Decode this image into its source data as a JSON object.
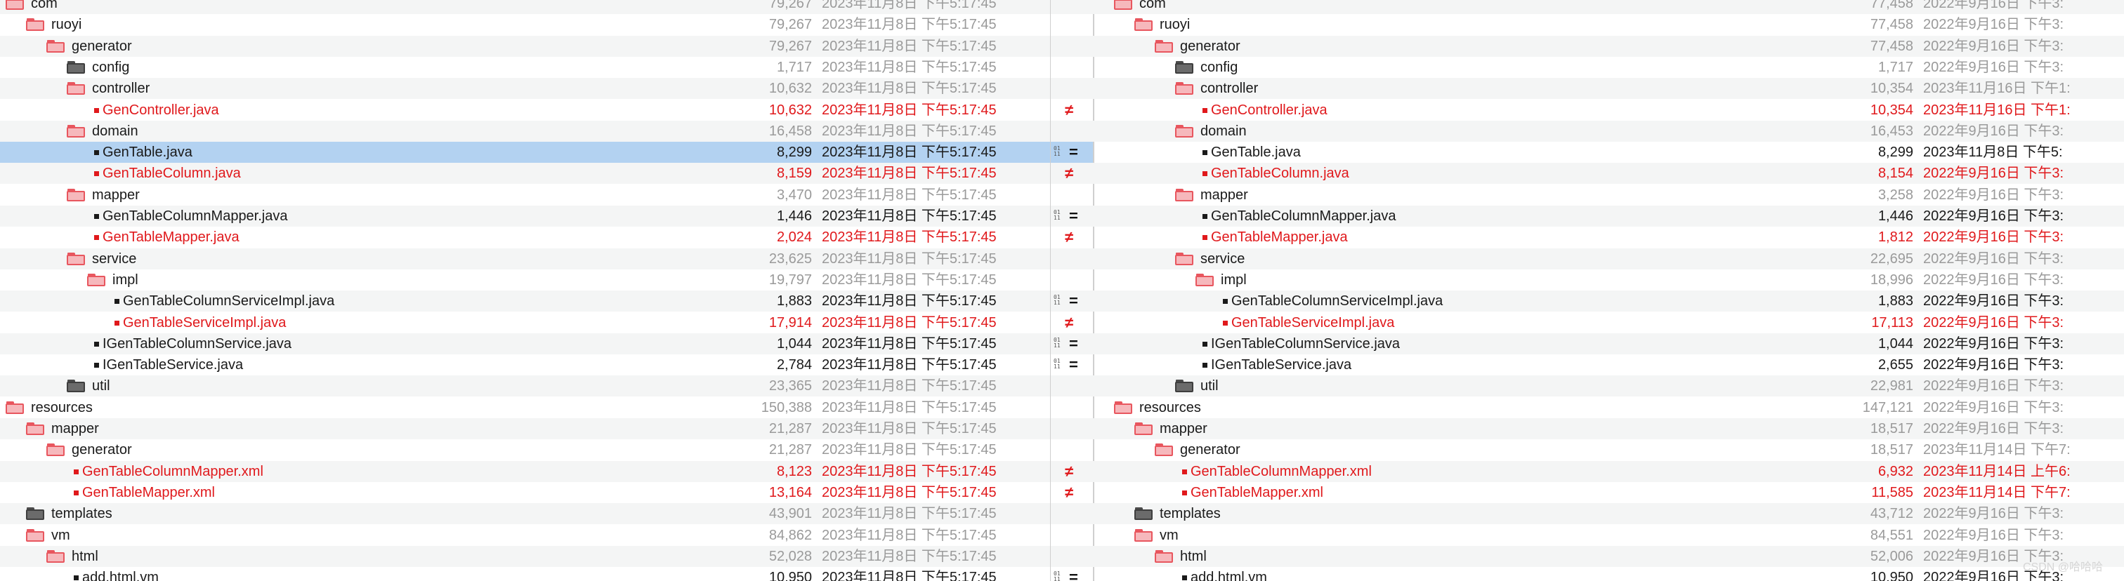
{
  "colors": {
    "changed": "#e0191c",
    "dim": "#9a9a9a",
    "selection": "#b3d2f1",
    "open_folder": "#e8565e",
    "closed_folder": "#5a5a5a"
  },
  "left_rows": [
    {
      "name": "com",
      "size": "79,267",
      "date": "2023年11月8日 下午5:17:45"
    },
    {
      "name": "ruoyi",
      "size": "79,267",
      "date": "2023年11月8日 下午5:17:45"
    },
    {
      "name": "generator",
      "size": "79,267",
      "date": "2023年11月8日 下午5:17:45"
    },
    {
      "name": "config",
      "size": "1,717",
      "date": "2023年11月8日 下午5:17:45"
    },
    {
      "name": "controller",
      "size": "10,632",
      "date": "2023年11月8日 下午5:17:45"
    },
    {
      "name": "GenController.java",
      "size": "10,632",
      "date": "2023年11月8日 下午5:17:45"
    },
    {
      "name": "domain",
      "size": "16,458",
      "date": "2023年11月8日 下午5:17:45"
    },
    {
      "name": "GenTable.java",
      "size": "8,299",
      "date": "2023年11月8日 下午5:17:45"
    },
    {
      "name": "GenTableColumn.java",
      "size": "8,159",
      "date": "2023年11月8日 下午5:17:45"
    },
    {
      "name": "mapper",
      "size": "3,470",
      "date": "2023年11月8日 下午5:17:45"
    },
    {
      "name": "GenTableColumnMapper.java",
      "size": "1,446",
      "date": "2023年11月8日 下午5:17:45"
    },
    {
      "name": "GenTableMapper.java",
      "size": "2,024",
      "date": "2023年11月8日 下午5:17:45"
    },
    {
      "name": "service",
      "size": "23,625",
      "date": "2023年11月8日 下午5:17:45"
    },
    {
      "name": "impl",
      "size": "19,797",
      "date": "2023年11月8日 下午5:17:45"
    },
    {
      "name": "GenTableColumnServiceImpl.java",
      "size": "1,883",
      "date": "2023年11月8日 下午5:17:45"
    },
    {
      "name": "GenTableServiceImpl.java",
      "size": "17,914",
      "date": "2023年11月8日 下午5:17:45"
    },
    {
      "name": "IGenTableColumnService.java",
      "size": "1,044",
      "date": "2023年11月8日 下午5:17:45"
    },
    {
      "name": "IGenTableService.java",
      "size": "2,784",
      "date": "2023年11月8日 下午5:17:45"
    },
    {
      "name": "util",
      "size": "23,365",
      "date": "2023年11月8日 下午5:17:45"
    },
    {
      "name": "resources",
      "size": "150,388",
      "date": "2023年11月8日 下午5:17:45"
    },
    {
      "name": "mapper",
      "size": "21,287",
      "date": "2023年11月8日 下午5:17:45"
    },
    {
      "name": "generator",
      "size": "21,287",
      "date": "2023年11月8日 下午5:17:45"
    },
    {
      "name": "GenTableColumnMapper.xml",
      "size": "8,123",
      "date": "2023年11月8日 下午5:17:45"
    },
    {
      "name": "GenTableMapper.xml",
      "size": "13,164",
      "date": "2023年11月8日 下午5:17:45"
    },
    {
      "name": "templates",
      "size": "43,901",
      "date": "2023年11月8日 下午5:17:45"
    },
    {
      "name": "vm",
      "size": "84,862",
      "date": "2023年11月8日 下午5:17:45"
    },
    {
      "name": "html",
      "size": "52,028",
      "date": "2023年11月8日 下午5:17:45"
    },
    {
      "name": "add.html.vm",
      "size": "10,950",
      "date": "2023年11月8日 下午5:17:45"
    }
  ],
  "right_rows": [
    {
      "name": "com",
      "size": "77,458",
      "date": "2022年9月16日 下午3:"
    },
    {
      "name": "ruoyi",
      "size": "77,458",
      "date": "2022年9月16日 下午3:"
    },
    {
      "name": "generator",
      "size": "77,458",
      "date": "2022年9月16日 下午3:"
    },
    {
      "name": "config",
      "size": "1,717",
      "date": "2022年9月16日 下午3:"
    },
    {
      "name": "controller",
      "size": "10,354",
      "date": "2023年11月16日 下午1:"
    },
    {
      "name": "GenController.java",
      "size": "10,354",
      "date": "2023年11月16日 下午1:"
    },
    {
      "name": "domain",
      "size": "16,453",
      "date": "2022年9月16日 下午3:"
    },
    {
      "name": "GenTable.java",
      "size": "8,299",
      "date": "2023年11月8日 下午5:"
    },
    {
      "name": "GenTableColumn.java",
      "size": "8,154",
      "date": "2022年9月16日 下午3:"
    },
    {
      "name": "mapper",
      "size": "3,258",
      "date": "2022年9月16日 下午3:"
    },
    {
      "name": "GenTableColumnMapper.java",
      "size": "1,446",
      "date": "2022年9月16日 下午3:"
    },
    {
      "name": "GenTableMapper.java",
      "size": "1,812",
      "date": "2022年9月16日 下午3:"
    },
    {
      "name": "service",
      "size": "22,695",
      "date": "2022年9月16日 下午3:"
    },
    {
      "name": "impl",
      "size": "18,996",
      "date": "2022年9月16日 下午3:"
    },
    {
      "name": "GenTableColumnServiceImpl.java",
      "size": "1,883",
      "date": "2022年9月16日 下午3:"
    },
    {
      "name": "GenTableServiceImpl.java",
      "size": "17,113",
      "date": "2022年9月16日 下午3:"
    },
    {
      "name": "IGenTableColumnService.java",
      "size": "1,044",
      "date": "2022年9月16日 下午3:"
    },
    {
      "name": "IGenTableService.java",
      "size": "2,655",
      "date": "2022年9月16日 下午3:"
    },
    {
      "name": "util",
      "size": "22,981",
      "date": "2022年9月16日 下午3:"
    },
    {
      "name": "resources",
      "size": "147,121",
      "date": "2022年9月16日 下午3:"
    },
    {
      "name": "mapper",
      "size": "18,517",
      "date": "2022年9月16日 下午3:"
    },
    {
      "name": "generator",
      "size": "18,517",
      "date": "2023年11月14日 下午7:"
    },
    {
      "name": "GenTableColumnMapper.xml",
      "size": "6,932",
      "date": "2023年11月14日 上午6:"
    },
    {
      "name": "GenTableMapper.xml",
      "size": "11,585",
      "date": "2023年11月14日 下午7:"
    },
    {
      "name": "templates",
      "size": "43,712",
      "date": "2022年9月16日 下午3:"
    },
    {
      "name": "vm",
      "size": "84,551",
      "date": "2022年9月16日 下午3:"
    },
    {
      "name": "html",
      "size": "52,006",
      "date": "2022年9月16日 下午3:"
    },
    {
      "name": "add.html.vm",
      "size": "10,950",
      "date": "2022年9月16日 下午3:"
    }
  ],
  "gutter_marks": [
    "",
    "",
    "",
    "",
    "",
    "≠",
    "",
    "=",
    "≠",
    "",
    "=",
    "≠",
    "",
    "",
    "=",
    "≠",
    "=",
    "=",
    "",
    "",
    "",
    "",
    "≠",
    "≠",
    "",
    "",
    "",
    "="
  ],
  "binary_glyph": "01\n11",
  "watermark": "CSDN @哈哈哈"
}
